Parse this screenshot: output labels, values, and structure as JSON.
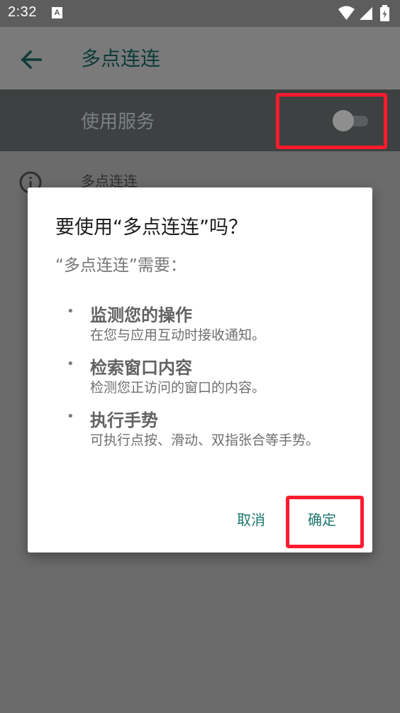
{
  "status_bar": {
    "time": "2:32",
    "a_icon_label": "A"
  },
  "toolbar": {
    "title": "多点连连"
  },
  "service": {
    "label": "使用服务",
    "switch_on": false
  },
  "info": {
    "text": "多点连连"
  },
  "dialog": {
    "title": "要使用“多点连连”吗？",
    "subtitle": "“多点连连”需要：",
    "permissions": [
      {
        "bullet": "•",
        "title": "监测您的操作",
        "desc": "在您与应用互动时接收通知。"
      },
      {
        "bullet": "•",
        "title": "检索窗口内容",
        "desc": "检测您正访问的窗口的内容。"
      },
      {
        "bullet": "•",
        "title": "执行手势",
        "desc": "可执行点按、滑动、双指张合等手势。"
      }
    ],
    "cancel_label": "取消",
    "confirm_label": "确定"
  },
  "colors": {
    "accent": "#1b756e",
    "highlight": "#ff1a2d"
  }
}
